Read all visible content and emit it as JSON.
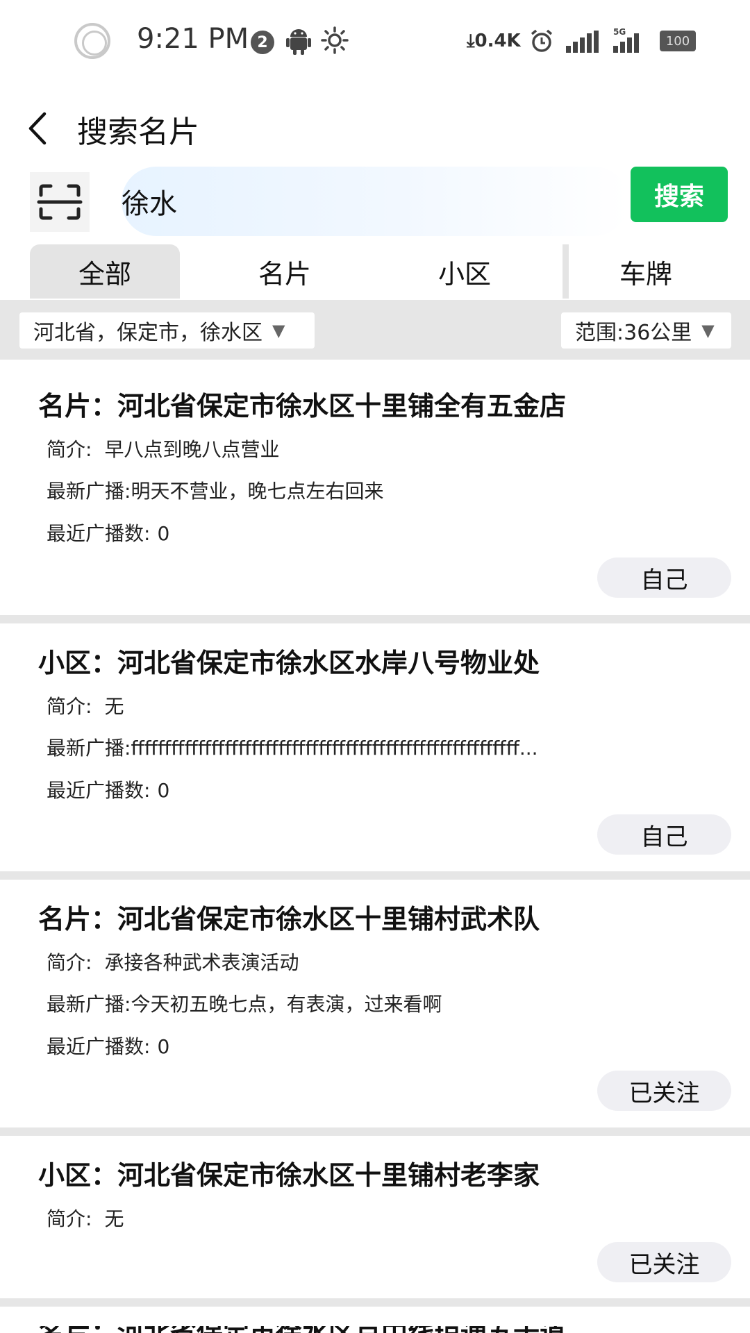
{
  "status": {
    "time": "9:21 PM",
    "notif_count": "2",
    "net_speed": "0.4K",
    "battery": "100",
    "signal2_label": "5G"
  },
  "header": {
    "title": "搜索名片"
  },
  "search": {
    "value": "徐水",
    "button_label": "搜索"
  },
  "tabs": [
    {
      "label": "全部"
    },
    {
      "label": "名片"
    },
    {
      "label": "小区"
    },
    {
      "label": "车牌"
    }
  ],
  "filters": {
    "region": "河北省，保定市，徐水区",
    "range": "范围:36公里"
  },
  "labels": {
    "intro": "简介:",
    "latest": "最新广播:",
    "count": "最近广播数:"
  },
  "cards": [
    {
      "title": "名片：河北省保定市徐水区十里铺全有五金店",
      "intro": "早八点到晚八点营业",
      "latest": "明天不营业，晚七点左右回来",
      "count": "0",
      "button": "自己"
    },
    {
      "title": "小区：河北省保定市徐水区水岸八号物业处",
      "intro": "无",
      "latest": "ffffffffffffffffffffffffffffffffffffffffffffffffffffffffff...",
      "count": "0",
      "button": "自己"
    },
    {
      "title": "名片：河北省保定市徐水区十里铺村武术队",
      "intro": "承接各种武术表演活动",
      "latest": "今天初五晚七点，有表演，过来看啊",
      "count": "0",
      "button": "已关注"
    },
    {
      "title": "小区：河北省保定市徐水区十里铺村老李家",
      "intro": "无",
      "button": "已关注"
    }
  ],
  "partial_card": {
    "title": "名片：河北省保定市徐水区京中线琼通五十道"
  }
}
